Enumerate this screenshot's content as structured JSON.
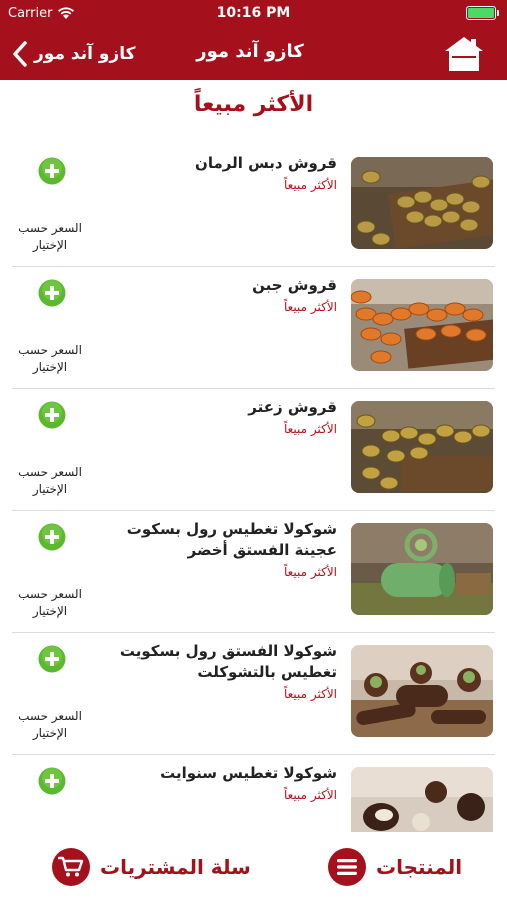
{
  "status_bar": {
    "carrier": "Carrier",
    "time": "10:16 PM"
  },
  "nav": {
    "back_label": "كازو آند مور",
    "title": "كازو آند مور"
  },
  "section_title": "الأكثر مبيعاً",
  "products": [
    {
      "name": "قروش دبس الرمان",
      "tag": "الأكثر مبيعاً",
      "price_label": "السعر حسب الإختيار"
    },
    {
      "name": "قروش جبن",
      "tag": "الأكثر مبيعاً",
      "price_label": "السعر حسب الإختيار"
    },
    {
      "name": "قروش زعتر",
      "tag": "الأكثر مبيعاً",
      "price_label": "السعر حسب الإختيار"
    },
    {
      "name": "شوكولا تغطيس رول بسكوت عجينة الفستق أخضر",
      "tag": "الأكثر مبيعاً",
      "price_label": "السعر حسب الإختيار"
    },
    {
      "name": "شوكولا الفستق رول بسكويت تغطيس بالتشوكلت",
      "tag": "الأكثر مبيعاً",
      "price_label": "السعر حسب الإختيار"
    },
    {
      "name": "شوكولا تغطيس سنوايت",
      "tag": "الأكثر مبيعاً",
      "price_label": ""
    }
  ],
  "bottom_bar": {
    "cart_label": "سلة المشتريات",
    "products_label": "المنتجات"
  },
  "colors": {
    "brand": "#a4111c",
    "add_button": "#5cb82e",
    "battery": "#4cd964"
  },
  "icons": [
    "wifi-icon",
    "battery-icon",
    "chevron-left-icon",
    "home-icon",
    "plus-icon",
    "cart-icon",
    "menu-icon"
  ]
}
